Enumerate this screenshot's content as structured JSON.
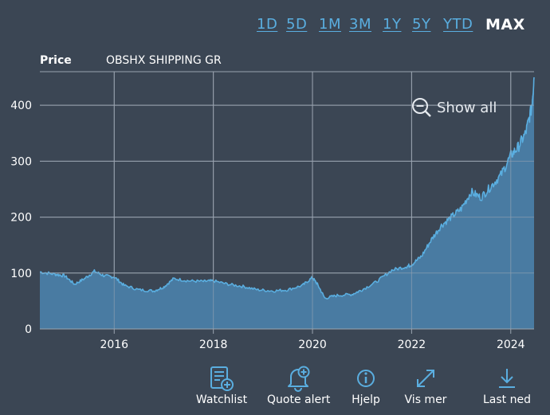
{
  "range_tabs": [
    "1D",
    "5D",
    "1M",
    "3M",
    "1Y",
    "5Y",
    "YTD",
    "MAX"
  ],
  "active_range": "MAX",
  "legend": {
    "price_label": "Price",
    "series_name": "OBSHX SHIPPING GR"
  },
  "show_all_label": "Show all",
  "toolbar": {
    "watchlist": "Watchlist",
    "quote_alert": "Quote alert",
    "help": "Hjelp",
    "more": "Vis mer",
    "download": "Last ned"
  },
  "colors": {
    "background": "#3b4654",
    "accent": "#5aaee0",
    "fill": "#4a7ea6",
    "grid": "#9aa4b0"
  },
  "chart_data": {
    "type": "area",
    "series": [
      {
        "name": "OBSHX SHIPPING GR",
        "x": [
          2014.5,
          2014.8,
          2015.0,
          2015.2,
          2015.4,
          2015.6,
          2015.8,
          2016.0,
          2016.2,
          2016.5,
          2016.8,
          2017.0,
          2017.2,
          2017.5,
          2017.8,
          2018.0,
          2018.3,
          2018.6,
          2018.9,
          2019.2,
          2019.5,
          2019.8,
          2020.0,
          2020.1,
          2020.25,
          2020.5,
          2020.8,
          2021.0,
          2021.3,
          2021.6,
          2021.9,
          2022.0,
          2022.2,
          2022.4,
          2022.6,
          2022.8,
          2023.0,
          2023.2,
          2023.4,
          2023.6,
          2023.8,
          2024.0,
          2024.15,
          2024.3,
          2024.42,
          2024.47
        ],
        "y": [
          102,
          98,
          95,
          80,
          90,
          103,
          95,
          93,
          78,
          70,
          68,
          75,
          90,
          86,
          85,
          86,
          80,
          76,
          70,
          68,
          70,
          78,
          92,
          80,
          55,
          60,
          62,
          70,
          85,
          105,
          112,
          115,
          130,
          160,
          185,
          200,
          215,
          245,
          235,
          255,
          275,
          310,
          325,
          350,
          395,
          450
        ]
      }
    ],
    "xlim": [
      2014.5,
      2024.47
    ],
    "ylim": [
      0,
      460
    ],
    "x_ticks": [
      2016,
      2018,
      2020,
      2022,
      2024
    ],
    "y_ticks": [
      0,
      100,
      200,
      300,
      400
    ],
    "grid": true
  }
}
